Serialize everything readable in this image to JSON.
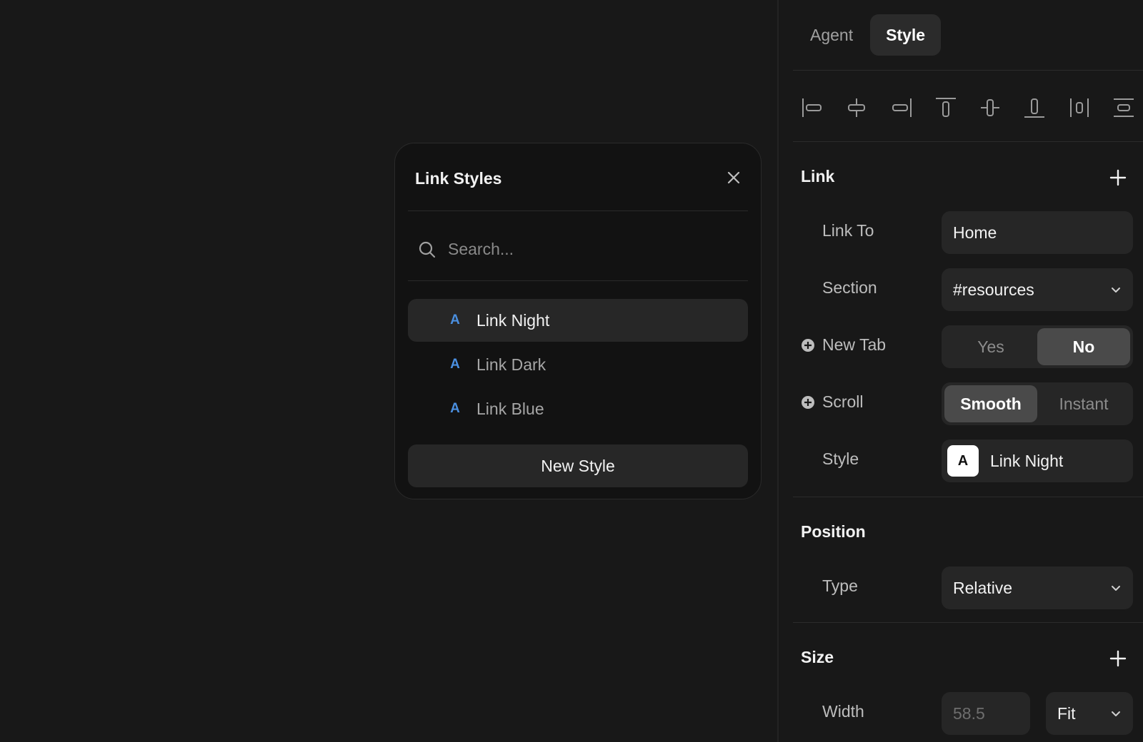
{
  "popup": {
    "title": "Link Styles",
    "search_placeholder": "Search...",
    "items": [
      {
        "glyph": "A",
        "label": "Link Night"
      },
      {
        "glyph": "A",
        "label": "Link Dark"
      },
      {
        "glyph": "A",
        "label": "Link Blue"
      }
    ],
    "new_style_label": "New Style"
  },
  "panel": {
    "tabs": [
      {
        "label": "Agent"
      },
      {
        "label": "Style"
      }
    ],
    "link": {
      "title": "Link",
      "link_to_label": "Link To",
      "link_to_value": "Home",
      "section_label": "Section",
      "section_value": "#resources",
      "new_tab_label": "New Tab",
      "new_tab_options": [
        "Yes",
        "No"
      ],
      "scroll_label": "Scroll",
      "scroll_options": [
        "Smooth",
        "Instant"
      ],
      "style_label": "Style",
      "style_glyph": "A",
      "style_value": "Link Night"
    },
    "position": {
      "title": "Position",
      "type_label": "Type",
      "type_value": "Relative"
    },
    "size": {
      "title": "Size",
      "width_label": "Width",
      "width_value": "58.5",
      "width_mode": "Fit"
    }
  },
  "colors": {
    "accent_glyph": "#4a8fe0",
    "background": "#181818",
    "field": "#262626"
  }
}
